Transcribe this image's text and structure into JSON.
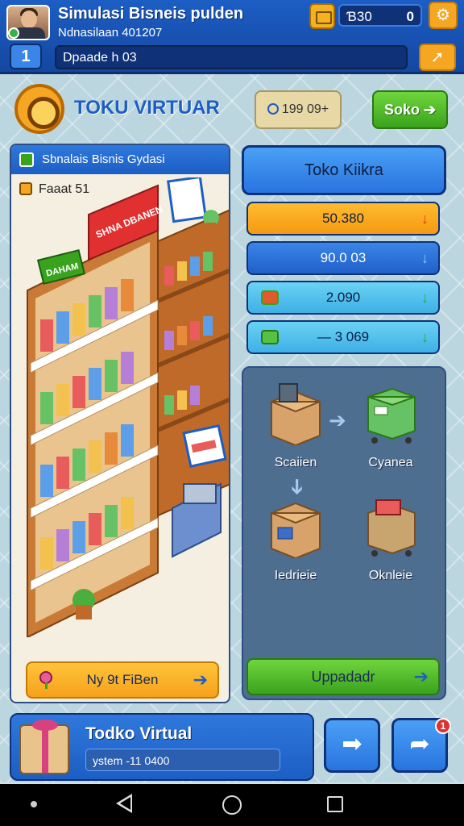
{
  "header": {
    "title": "Simulasi Bisneis pulden",
    "subtitle": "Ndnasilaan 401207",
    "coin_label": "Ɓ30",
    "coin_value": "0",
    "level": "1",
    "progress_text": "Dpaade h 03"
  },
  "store": {
    "title": "TOKU VIRTUAR",
    "pill_value": "199 09+",
    "action_label": "Soko"
  },
  "left_panel": {
    "header": "Sbnalais Bisnis Gydasi",
    "row_label": "Faaat 51",
    "shelf_sign": "SHNA DBANEN",
    "green_sign": "DAHAM",
    "button_label": "Ny 9t FiBen"
  },
  "right_panel": {
    "title": "Toko Kiikra",
    "stats": [
      "50.380",
      "90.0 03",
      "2.090",
      "— 3 069"
    ],
    "flow": {
      "item1": "Scaiien",
      "item2": "Cyanea",
      "item3": "Iedrieie",
      "item4": "Oknleie"
    },
    "update_label": "Uppadadr"
  },
  "bottom": {
    "title": "Todko Virtual",
    "input_text": "ystem -11 0400",
    "notification_count": "1"
  },
  "colors": {
    "primary_blue": "#1c5ec4",
    "accent_orange": "#f5a623",
    "accent_green": "#3aa31d"
  },
  "icons": [
    "avatar",
    "online-dot-icon",
    "coin-box-icon",
    "settings-icon",
    "level-badge",
    "forward-arrow-icon",
    "store-wheel-icon",
    "clock-icon",
    "bag-icon",
    "square-icon",
    "lollipop-icon",
    "arrow-right-icon",
    "gift-icon",
    "share-icon",
    "reply-icon"
  ]
}
